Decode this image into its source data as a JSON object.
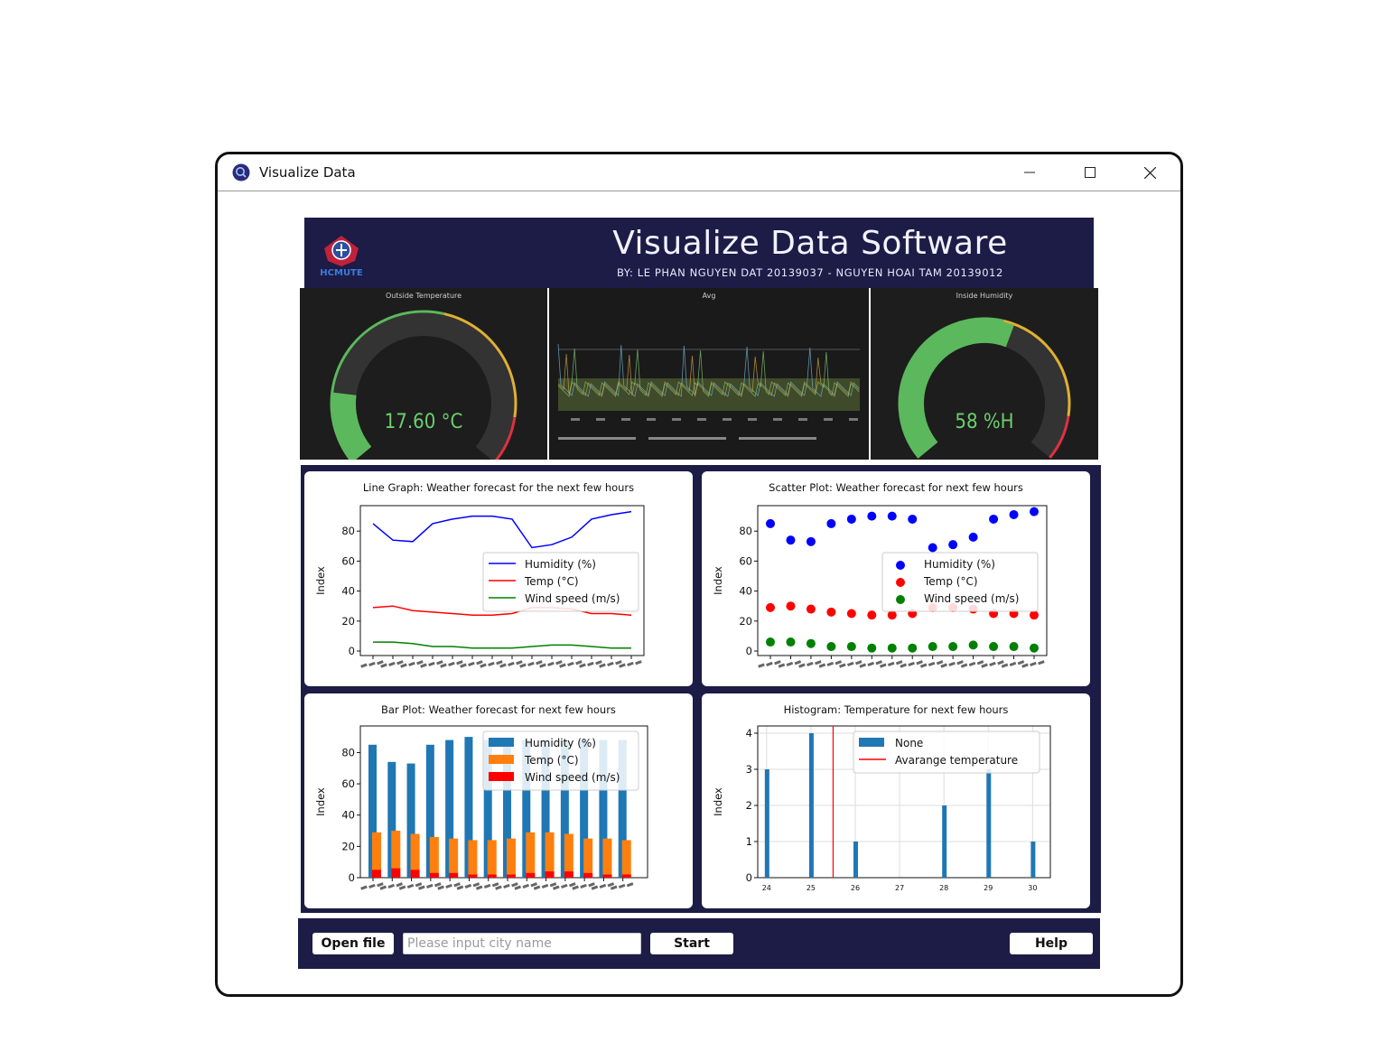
{
  "window": {
    "title": "Visualize Data"
  },
  "banner": {
    "title": "Visualize Data Software",
    "subtitle": "BY: LE PHAN NGUYEN DAT 20139037 - NGUYEN HOAI TAM 20139012",
    "logo_text": "HCMUTE"
  },
  "dashboard": {
    "outside": {
      "title": "Outside Temperature",
      "value": "17.60 °C",
      "level": 0.18
    },
    "trend": {
      "title": "Avg"
    },
    "inside": {
      "title": "Inside Humidity",
      "value": "58 %H",
      "level": 0.58
    }
  },
  "colors": {
    "navy": "#1c1c47",
    "humidity": "#0000ff",
    "temp": "#ff0000",
    "wind": "#008000",
    "bar_humidity": "#1f77b4",
    "bar_temp": "#ff7f0e",
    "bar_wind": "#ff0000",
    "gauge_green": "#5cb85c",
    "gauge_yellow": "#e0b030",
    "gauge_red": "#e03040"
  },
  "chart_data": [
    {
      "type": "line",
      "title": "Line Graph: Weather forecast for the next few hours",
      "ylabel": "Index",
      "ylim": [
        -3,
        97
      ],
      "yticks": [
        0,
        20,
        40,
        60,
        80
      ],
      "series": [
        {
          "name": "Humidity (%)",
          "values": [
            85,
            74,
            73,
            85,
            88,
            90,
            90,
            88,
            69,
            71,
            76,
            88,
            91,
            93
          ]
        },
        {
          "name": "Temp (°C)",
          "values": [
            29,
            30,
            27,
            26,
            25,
            24,
            24,
            25,
            29,
            29,
            28,
            25,
            25,
            24
          ]
        },
        {
          "name": "Wind speed (m/s)",
          "values": [
            6,
            6,
            5,
            3,
            3,
            2,
            2,
            2,
            3,
            4,
            4,
            3,
            2,
            2
          ]
        }
      ]
    },
    {
      "type": "scatter",
      "title": "Scatter Plot: Weather forecast for next few hours",
      "ylabel": "Index",
      "ylim": [
        -3,
        97
      ],
      "yticks": [
        0,
        20,
        40,
        60,
        80
      ],
      "series": [
        {
          "name": "Humidity (%)",
          "values": [
            85,
            74,
            73,
            85,
            88,
            90,
            90,
            88,
            69,
            71,
            76,
            88,
            91,
            93
          ]
        },
        {
          "name": "Temp (°C)",
          "values": [
            29,
            30,
            28,
            26,
            25,
            24,
            24,
            25,
            29,
            29,
            28,
            25,
            25,
            24
          ]
        },
        {
          "name": "Wind speed (m/s)",
          "values": [
            6,
            6,
            5,
            3,
            3,
            2,
            2,
            2,
            3,
            3,
            4,
            3,
            3,
            2
          ]
        }
      ]
    },
    {
      "type": "bar",
      "title": "Bar Plot: Weather forecast for next few hours",
      "ylabel": "Index",
      "ylim": [
        0,
        97
      ],
      "yticks": [
        0,
        20,
        40,
        60,
        80
      ],
      "series": [
        {
          "name": "Humidity (%)",
          "values": [
            85,
            74,
            73,
            85,
            88,
            90,
            88,
            88,
            88,
            88,
            88,
            88,
            88,
            88
          ]
        },
        {
          "name": "Temp (°C)",
          "values": [
            29,
            30,
            28,
            26,
            25,
            24,
            24,
            25,
            29,
            29,
            28,
            25,
            25,
            24
          ]
        },
        {
          "name": "Wind speed (m/s)",
          "values": [
            5,
            6,
            5,
            3,
            3,
            2,
            2,
            2,
            3,
            4,
            4,
            3,
            2,
            2
          ]
        }
      ]
    },
    {
      "type": "bar",
      "title": "Histogram: Temperature for next few hours",
      "ylabel": "Index",
      "xlim": [
        23.8,
        30.4
      ],
      "ylim": [
        0,
        4.2
      ],
      "xticks": [
        "24",
        "25",
        "26",
        "27",
        "28",
        "29",
        "30"
      ],
      "yticks": [
        0,
        1,
        2,
        3,
        4
      ],
      "bins": [
        {
          "x": 24,
          "count": 3
        },
        {
          "x": 25,
          "count": 4
        },
        {
          "x": 26,
          "count": 1
        },
        {
          "x": 28,
          "count": 2
        },
        {
          "x": 29,
          "count": 3
        },
        {
          "x": 30,
          "count": 1
        }
      ],
      "average": 25.5,
      "legend": [
        "None",
        "Avarange temperature"
      ]
    }
  ],
  "controls": {
    "open_file": "Open file",
    "city_placeholder": "Please input city name",
    "start": "Start",
    "help": "Help"
  }
}
